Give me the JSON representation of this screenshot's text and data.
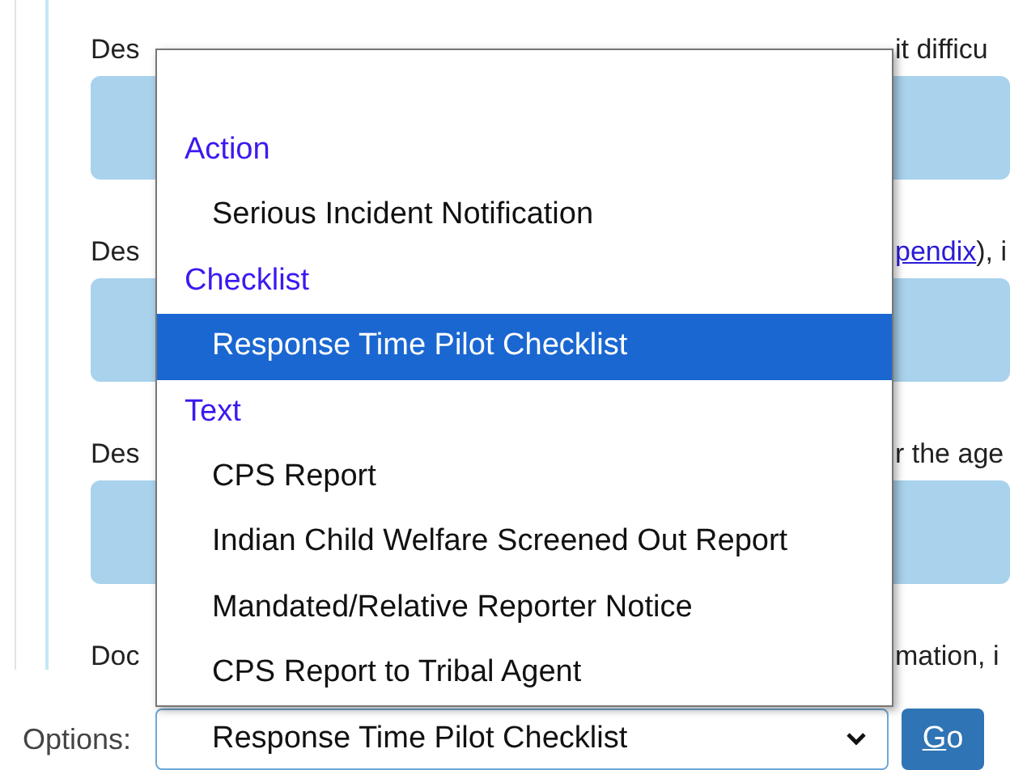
{
  "form": {
    "questions": [
      {
        "visible_start": "Des",
        "visible_end": "it difficu"
      },
      {
        "visible_start": "Des",
        "visible_end_link": "pendix",
        "visible_end": "), i"
      },
      {
        "visible_start": "Des",
        "visible_end": "r the age"
      },
      {
        "visible_start": "Doc",
        "visible_end": "mation, i"
      }
    ]
  },
  "options_menu": {
    "groups": [
      {
        "label": "Action",
        "items": [
          {
            "label": "Serious Incident Notification",
            "selected": false
          }
        ]
      },
      {
        "label": "Checklist",
        "items": [
          {
            "label": "Response Time Pilot Checklist",
            "selected": true
          }
        ]
      },
      {
        "label": "Text",
        "items": [
          {
            "label": "CPS Report",
            "selected": false
          },
          {
            "label": "Indian Child Welfare Screened Out Report",
            "selected": false
          },
          {
            "label": "Mandated/Relative Reporter Notice",
            "selected": false
          },
          {
            "label": "CPS Report to Tribal Agent",
            "selected": false
          }
        ]
      }
    ]
  },
  "options_bar": {
    "label": "Options:",
    "value": "Response Time Pilot Checklist",
    "button": "Go"
  }
}
